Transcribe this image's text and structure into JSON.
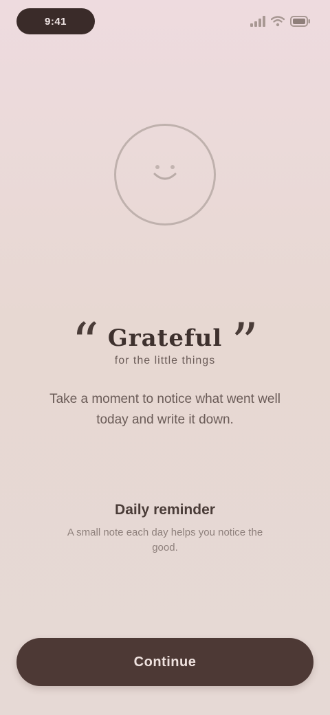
{
  "status_bar": {
    "time": "9:41",
    "icons": [
      "signal-icon",
      "wifi-icon",
      "battery-icon"
    ]
  },
  "hero": {
    "icon": "smile-face-icon"
  },
  "quote": {
    "open_mark": "“",
    "close_mark": "”",
    "title": "Grateful",
    "subtitle": "for the little things"
  },
  "description": "Take a moment to notice what went well today and write it down.",
  "note": {
    "title": "Daily reminder",
    "text": "A small note each day helps you notice the good."
  },
  "actions": {
    "primary_label": "Continue"
  },
  "colors": {
    "background_top": "#eedbdf",
    "background_bottom": "#e6d9d5",
    "primary_button": "#4d3935",
    "status_pill": "#3a2b29"
  }
}
